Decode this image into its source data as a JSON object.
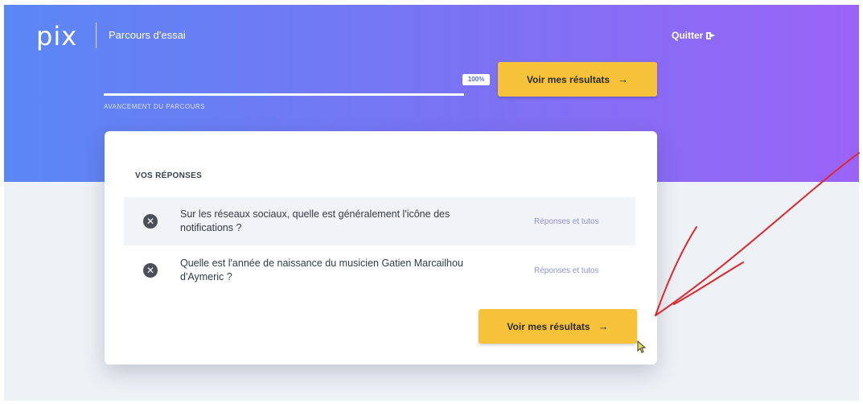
{
  "header": {
    "logo_text": "pix",
    "course_title": "Parcours d'essai",
    "quit_label": "Quitter",
    "quit_icon": "sign-out-icon"
  },
  "progress": {
    "value_label": "100%",
    "fraction": 1.0,
    "caption": "AVANCEMENT DU PARCOURS"
  },
  "top_button": {
    "label": "Voir mes résultats",
    "arrow": "→"
  },
  "answers_card": {
    "title": "VOS RÉPONSES",
    "items": [
      {
        "status_icon": "times-circle-icon",
        "status_glyph": "✕",
        "question": "Sur les réseaux sociaux, quelle est généralement l'icône des notifications ?",
        "link_label": "Réponses et tutos"
      },
      {
        "status_icon": "times-circle-icon",
        "status_glyph": "✕",
        "question": "Quelle est l'année de naissance du musicien Gatien Marcailhou d'Aymeric ?",
        "link_label": "Réponses et tutos"
      }
    ],
    "bottom_button": {
      "label": "Voir mes résultats",
      "arrow": "→"
    }
  },
  "colors": {
    "gradient_start": "#5b87f4",
    "gradient_end": "#9a63f7",
    "button_yellow": "#f5c23a",
    "link_color": "#8d92d6",
    "annotation_red": "#e0262b"
  }
}
